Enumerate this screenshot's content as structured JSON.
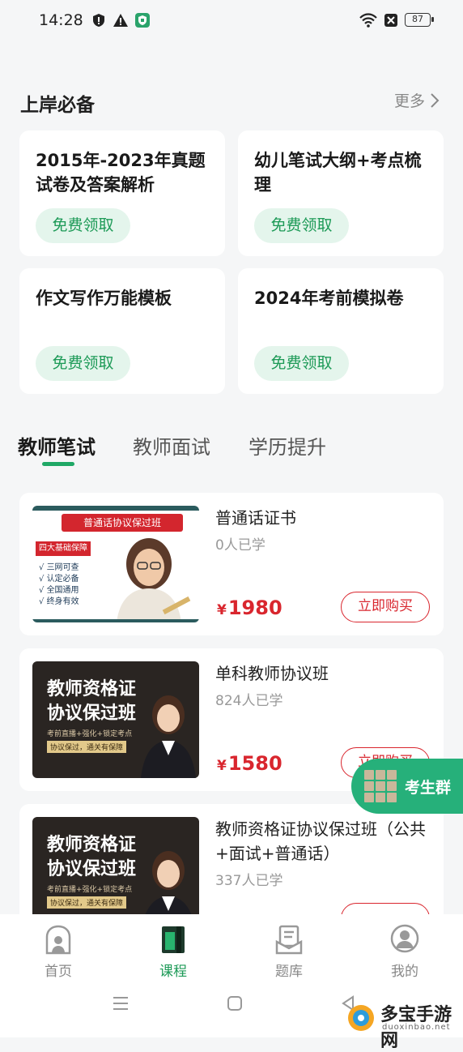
{
  "status_bar": {
    "time": "14:28",
    "battery": "87"
  },
  "section": {
    "title": "上岸必备",
    "more_label": "更多"
  },
  "resources": [
    {
      "title": "2015年-2023年真题试卷及答案解析",
      "button": "免费领取"
    },
    {
      "title": "幼儿笔试大纲+考点梳理",
      "button": "免费领取"
    },
    {
      "title": "作文写作万能模板",
      "button": "免费领取"
    },
    {
      "title": "2024年考前模拟卷",
      "button": "免费领取"
    }
  ],
  "tabs": [
    {
      "label": "教师笔试",
      "active": true
    },
    {
      "label": "教师面试",
      "active": false
    },
    {
      "label": "学历提升",
      "active": false
    }
  ],
  "courses": [
    {
      "title": "普通话证书",
      "students": "0人已学",
      "price": "1980",
      "currency": "¥",
      "buy_label": "立即购买",
      "thumb": {
        "banner": "普通话协议保过班",
        "tag": "四大基础保障",
        "points": [
          "三网可查",
          "认定必备",
          "全国通用",
          "终身有效"
        ]
      }
    },
    {
      "title": "单科教师协议班",
      "students": "824人已学",
      "price": "1580",
      "currency": "¥",
      "buy_label": "立即购买",
      "thumb": {
        "line1": "教师资格证",
        "line2": "协议保过班",
        "sub": "考前直播+强化+锁定考点",
        "tag": "协议保过，通关有保障"
      }
    },
    {
      "title": "教师资格证协议保过班（公共+面试+普通话）",
      "students": "337人已学",
      "price": "",
      "currency": "",
      "buy_label": "",
      "thumb": {
        "line1": "教师资格证",
        "line2": "协议保过班",
        "sub": "考前直播+强化+锁定考点",
        "tag": "协议保过，通关有保障"
      }
    }
  ],
  "float_group": {
    "label": "考生群"
  },
  "bottom_nav": [
    {
      "label": "首页",
      "icon": "home-icon",
      "active": false
    },
    {
      "label": "课程",
      "icon": "book-icon",
      "active": true
    },
    {
      "label": "题库",
      "icon": "question-bank-icon",
      "active": false
    },
    {
      "label": "我的",
      "icon": "profile-icon",
      "active": false
    }
  ],
  "watermark": {
    "text": "多宝手游网",
    "sub": "duoxinbao.net"
  },
  "colors": {
    "accent": "#1d9a57",
    "price": "#d9262e",
    "background": "#f5f6f7"
  }
}
